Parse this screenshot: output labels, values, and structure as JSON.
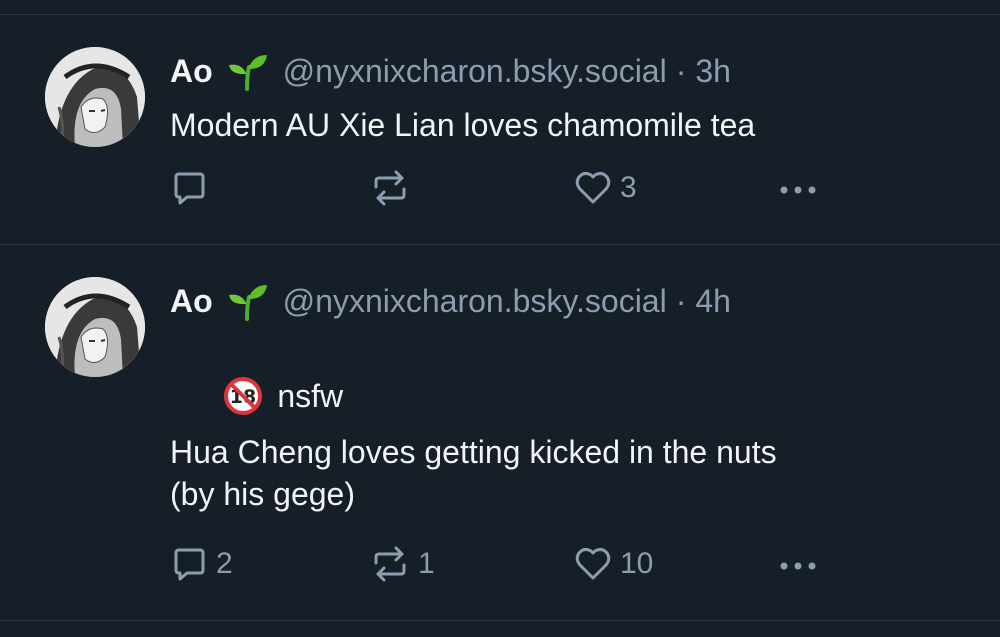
{
  "colors": {
    "background": "#161e27",
    "divider": "#2e3a48",
    "muted": "#8c9db0",
    "text": "#f1f3f5"
  },
  "posts": [
    {
      "author_name": "Ao",
      "author_emoji": "seedling-icon",
      "handle": "@nyxnixcharon.bsky.social",
      "separator": "·",
      "time": "3h",
      "label": "",
      "text": "Modern AU Xie Lian loves chamomile tea",
      "reply_count": "",
      "repost_count": "",
      "like_count": "3"
    },
    {
      "author_name": "Ao",
      "author_emoji": "seedling-icon",
      "handle": "@nyxnixcharon.bsky.social",
      "separator": "·",
      "time": "4h",
      "label": "nsfw",
      "text": "Hua Cheng loves getting kicked in the nuts\n(by his gege)",
      "reply_count": "2",
      "repost_count": "1",
      "like_count": "10"
    }
  ]
}
